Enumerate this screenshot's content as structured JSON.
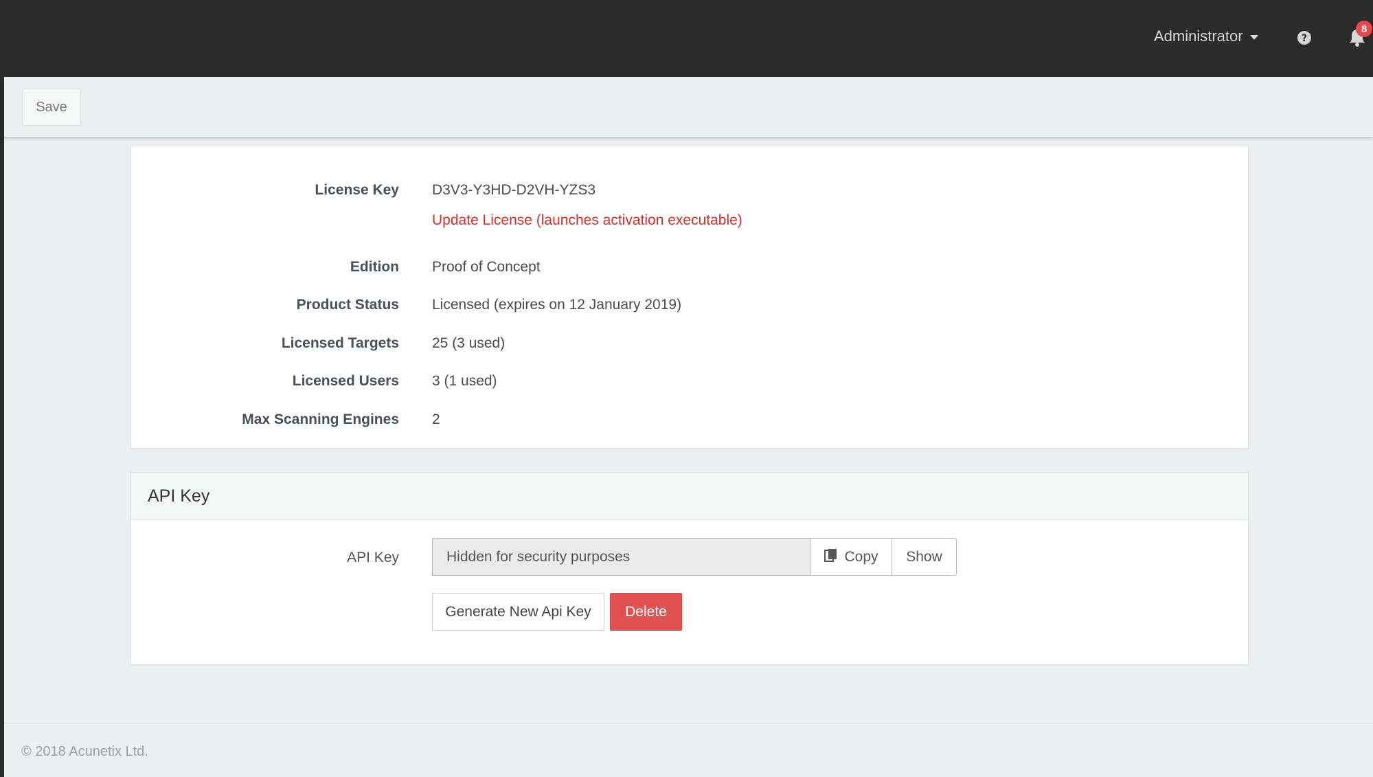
{
  "header": {
    "user_label": "Administrator",
    "notification_count": "8",
    "icons": {
      "help": "question-circle-icon",
      "notifications": "bell-icon",
      "user_menu": "caret-down-icon"
    }
  },
  "toolbar": {
    "save_label": "Save"
  },
  "license": {
    "rows": [
      {
        "label": "License Key",
        "value": "D3V3-Y3HD-D2VH-YZS3"
      },
      {
        "label": "Edition",
        "value": "Proof of Concept"
      },
      {
        "label": "Product Status",
        "value": "Licensed (expires on 12 January 2019)"
      },
      {
        "label": "Licensed Targets",
        "value": "25 (3 used)"
      },
      {
        "label": "Licensed Users",
        "value": "3 (1 used)"
      },
      {
        "label": "Max Scanning Engines",
        "value": "2"
      }
    ],
    "update_link": "Update License (launches activation executable)"
  },
  "api": {
    "panel_title": "API Key",
    "field_label": "API Key",
    "field_value": "Hidden for security purposes",
    "copy_label": "Copy",
    "show_label": "Show",
    "generate_label": "Generate New Api Key",
    "delete_label": "Delete",
    "icons": {
      "copy": "clipboard-copy-icon"
    }
  },
  "footer": {
    "copyright": "© 2018 Acunetix Ltd."
  },
  "colors": {
    "topbar": "#2b2b2b",
    "content_bg": "#edf0f0",
    "link_red": "#d2302c",
    "delete_red": "#e05252",
    "badge_red": "#e5484d"
  }
}
